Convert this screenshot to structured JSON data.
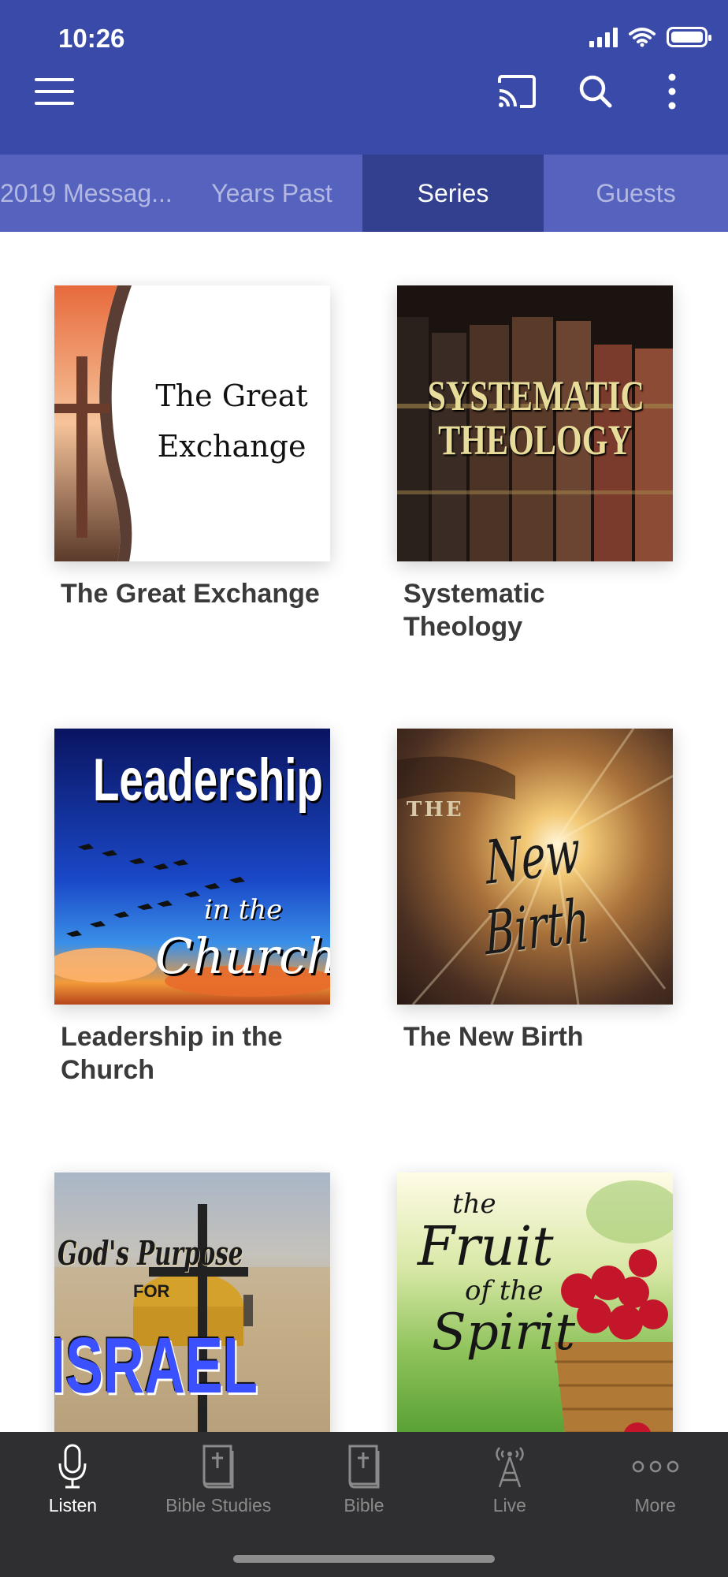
{
  "status_bar": {
    "time": "10:26"
  },
  "tabs": [
    {
      "label": "2019 Messag..."
    },
    {
      "label": "Years Past"
    },
    {
      "label": "Series"
    },
    {
      "label": "Guests"
    }
  ],
  "series": [
    {
      "title": "The Great Exchange",
      "art_text": [
        "The Great",
        "Exchange"
      ]
    },
    {
      "title": "Systematic Theology",
      "art_text": [
        "SYSTEMATIC",
        "THEOLOGY"
      ]
    },
    {
      "title": "Leadership in the Church",
      "art_text": [
        "Leadership",
        "in the",
        "Church"
      ]
    },
    {
      "title": "The New Birth",
      "art_text": [
        "THE",
        "New Birth"
      ]
    },
    {
      "title": "",
      "art_text": [
        "God's Purpose",
        "FOR",
        "ISRAEL"
      ]
    },
    {
      "title": "",
      "art_text": [
        "the",
        "Fruit",
        "of the",
        "Spirit"
      ]
    }
  ],
  "bottom_nav": [
    {
      "label": "Listen",
      "icon": "microphone-icon"
    },
    {
      "label": "Bible Studies",
      "icon": "book-icon"
    },
    {
      "label": "Bible",
      "icon": "bible-icon"
    },
    {
      "label": "Live",
      "icon": "broadcast-tower-icon"
    },
    {
      "label": "More",
      "icon": "more-dots-icon"
    }
  ],
  "colors": {
    "header": "#3a4aa8",
    "tabs": "#5563be",
    "tab_active": "#32408f",
    "bottom_nav": "#2f2f31"
  }
}
